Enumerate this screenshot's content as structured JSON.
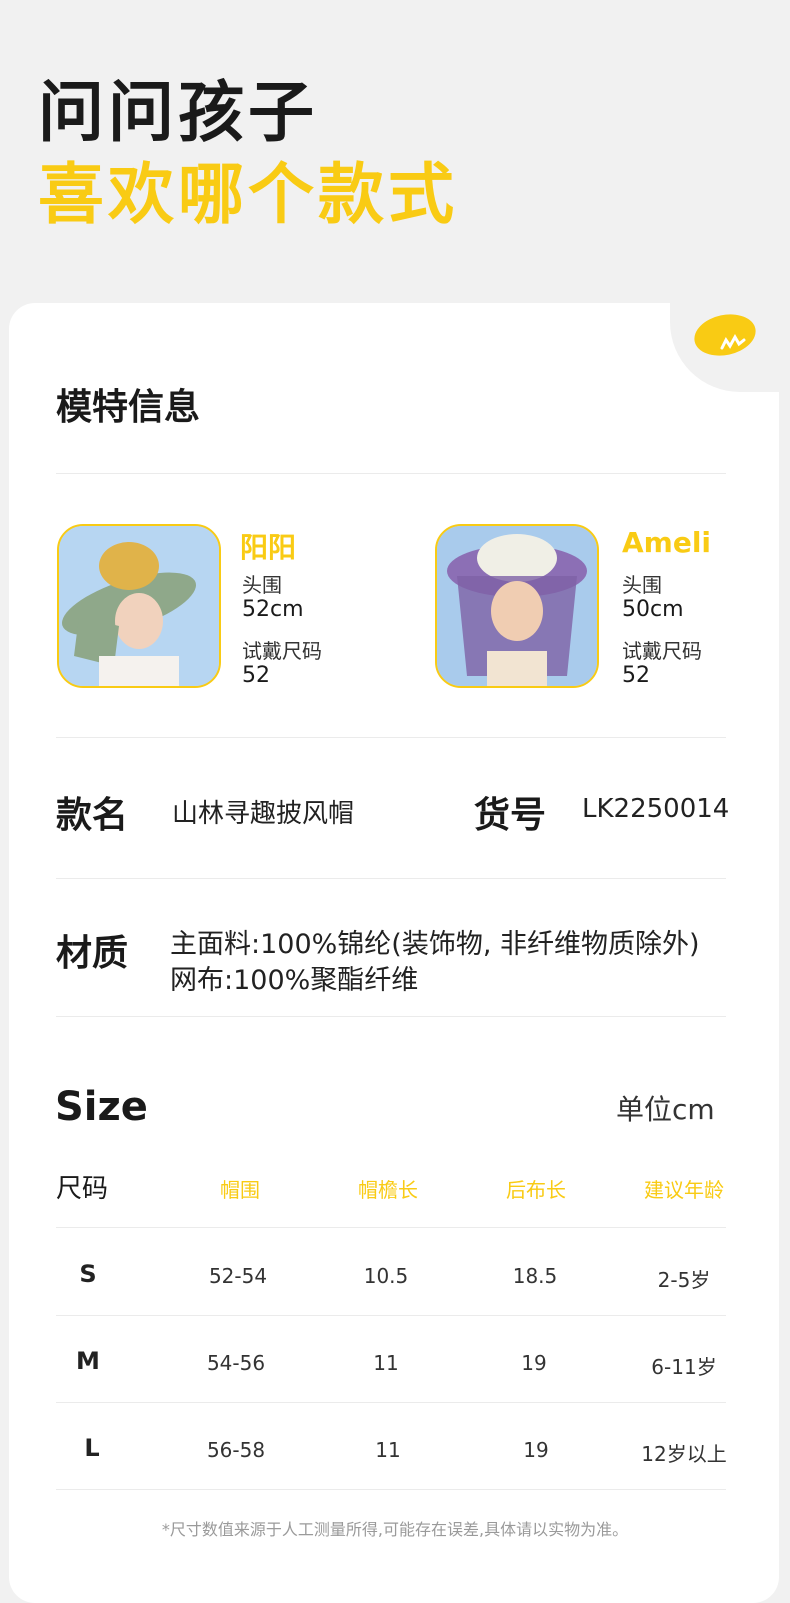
{
  "hero": {
    "line1": "问问孩子",
    "line2": "喜欢哪个款式"
  },
  "colors": {
    "accent": "#f9cb14",
    "background": "#f1f1f1",
    "card": "#ffffff"
  },
  "model_section": {
    "title": "模特信息",
    "models": [
      {
        "name": "阳阳",
        "head_label": "头围",
        "head_value": "52cm",
        "size_label": "试戴尺码",
        "size_value": "52"
      },
      {
        "name": "Ameli",
        "head_label": "头围",
        "head_value": "50cm",
        "size_label": "试戴尺码",
        "size_value": "52"
      }
    ]
  },
  "product": {
    "name_label": "款名",
    "name_value": "山林寻趣披风帽",
    "sku_label": "货号",
    "sku_value": "LK2250014",
    "material_label": "材质",
    "material_lines": [
      "主面料:100%锦纶(装饰物, 非纤维物质除外)",
      "网布:100%聚酯纤维"
    ]
  },
  "size_table": {
    "title": "Size",
    "unit": "单位cm",
    "headers": [
      "尺码",
      "帽围",
      "帽檐长",
      "后布长",
      "建议年龄"
    ],
    "rows": [
      [
        "S",
        "52-54",
        "10.5",
        "18.5",
        "2-5岁"
      ],
      [
        "M",
        "54-56",
        "11",
        "19",
        "6-11岁"
      ],
      [
        "L",
        "56-58",
        "11",
        "19",
        "12岁以上"
      ]
    ]
  },
  "footnote": "*尺寸数值来源于人工测量所得,可能存在误差,具体请以实物为准。"
}
